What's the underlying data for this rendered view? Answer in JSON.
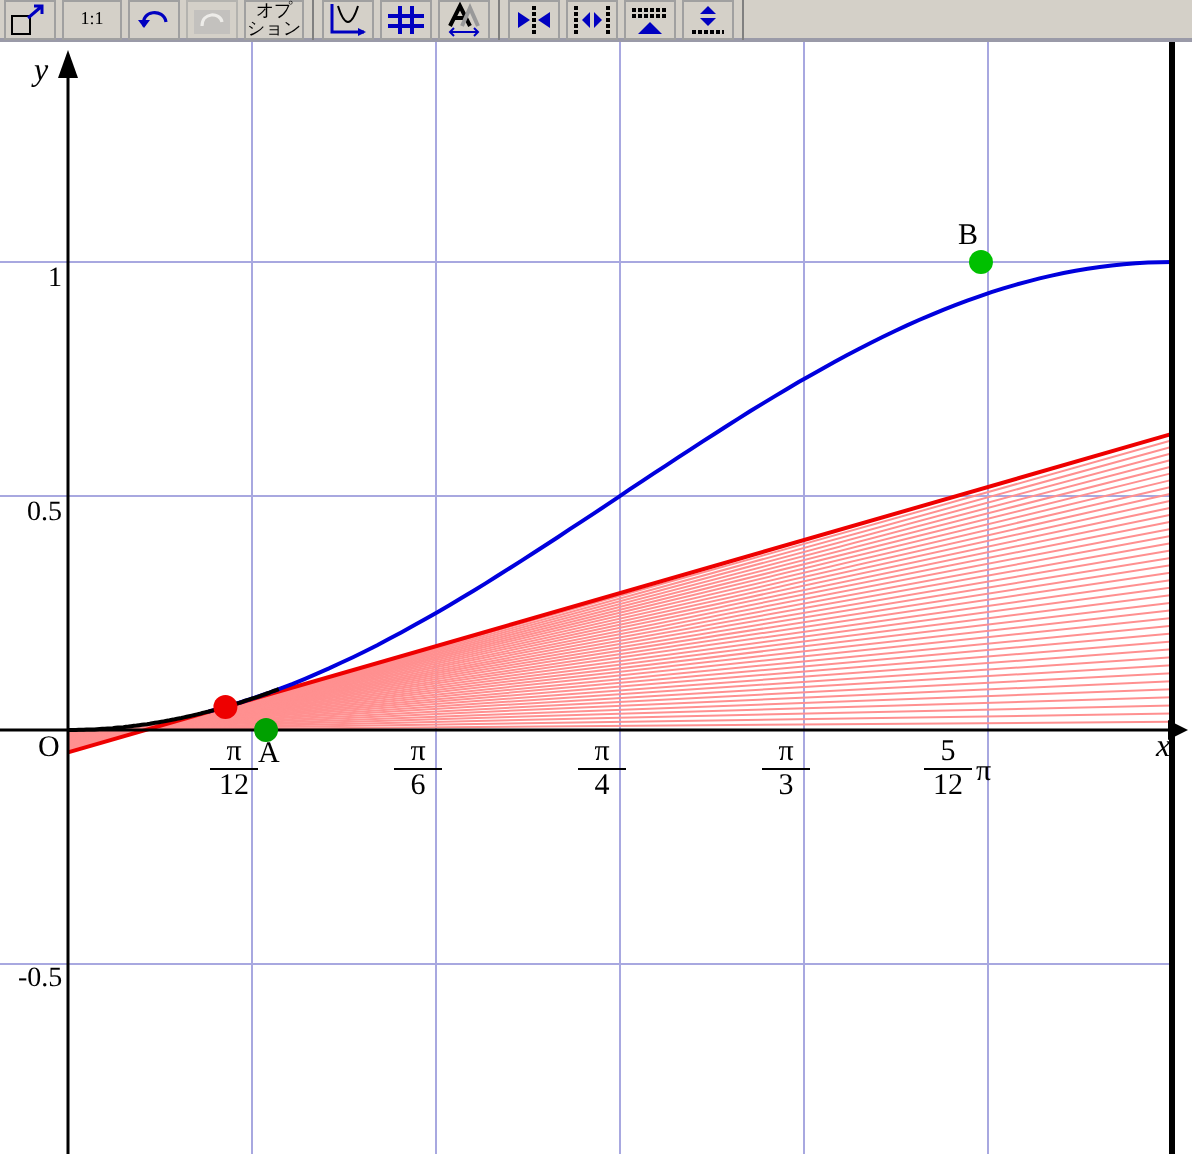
{
  "toolbar": {
    "groups": [
      [
        {
          "kind": "icon",
          "disabled": false
        },
        {
          "kind": "text",
          "label": "1:1",
          "disabled": false
        },
        {
          "kind": "icon",
          "disabled": false
        },
        {
          "kind": "icon",
          "disabled": true
        },
        {
          "kind": "text",
          "lines": [
            "オプ",
            "ション"
          ],
          "disabled": false
        }
      ],
      [
        {
          "kind": "icon",
          "disabled": false
        },
        {
          "kind": "icon",
          "disabled": false
        },
        {
          "kind": "icon",
          "disabled": false
        }
      ],
      [
        {
          "kind": "icon",
          "disabled": false
        },
        {
          "kind": "icon",
          "disabled": false
        },
        {
          "kind": "icon",
          "disabled": false
        },
        {
          "kind": "icon",
          "disabled": false
        }
      ]
    ]
  },
  "graph": {
    "y_axis_label": "y",
    "x_axis_label": "x",
    "origin_label": "O",
    "y_ticks": [
      "1",
      "0.5",
      "-0.5"
    ],
    "x_ticks": [
      {
        "numerator": "π",
        "denominator": "12"
      },
      {
        "numerator": "π",
        "denominator": "6"
      },
      {
        "numerator": "π",
        "denominator": "4"
      },
      {
        "numerator": "π",
        "denominator": "3"
      },
      {
        "numerator": "5",
        "denominator": "12",
        "suffix": "π"
      }
    ],
    "points": [
      {
        "label": "A",
        "color": "#00a000"
      },
      {
        "label": "B",
        "color": "#00c000"
      },
      {
        "color": "#ee0000"
      }
    ]
  }
}
